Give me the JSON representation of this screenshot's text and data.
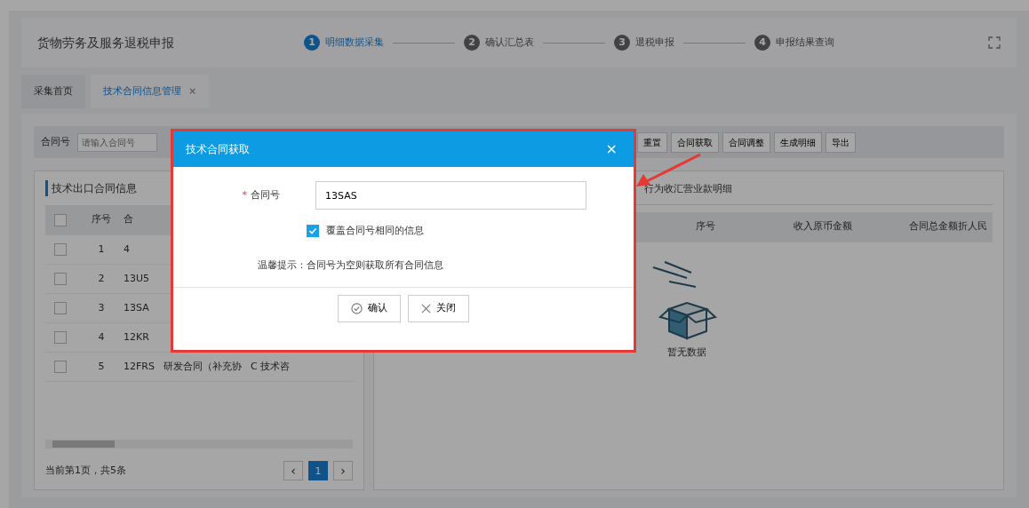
{
  "header": {
    "title": "货物劳务及服务退税申报",
    "steps": [
      {
        "number": "1",
        "label": "明细数据采集",
        "selected": true
      },
      {
        "number": "2",
        "label": "确认汇总表",
        "selected": false
      },
      {
        "number": "3",
        "label": "退税申报",
        "selected": false
      },
      {
        "number": "4",
        "label": "申报结果查询",
        "selected": false
      }
    ]
  },
  "tabs": [
    {
      "label": "采集首页",
      "selected": false
    },
    {
      "label": "技术合同信息管理",
      "selected": true,
      "close_icon": "×"
    }
  ],
  "search": {
    "label": "合同号",
    "placeholder": "请输入合同号"
  },
  "toolbar_buttons": [
    "重置",
    "合同获取",
    "合同调整",
    "生成明细",
    "导出"
  ],
  "left_panel": {
    "title": "技术出口合同信息",
    "select_all_checked": false,
    "columns": [
      "序号",
      "合"
    ],
    "rows": [
      {
        "checked": false,
        "cells": [
          "1",
          "4"
        ]
      },
      {
        "checked": false,
        "cells": [
          "2",
          "13U5"
        ]
      },
      {
        "checked": false,
        "cells": [
          "3",
          "13SA"
        ]
      },
      {
        "checked": false,
        "cells": [
          "4",
          "12KR"
        ]
      },
      {
        "checked": false,
        "cells": [
          "5",
          "12FRS",
          "研发合同（补充协",
          "C 技术咨"
        ]
      }
    ],
    "page_info": "当前第1页，共5条",
    "prev": "‹",
    "next": "›",
    "pages": [
      {
        "label": "1",
        "selected": true
      }
    ]
  },
  "right_panel": {
    "tab": "行为收汇营业款明细",
    "columns": [
      "序号",
      "收入原币金额",
      "合同总金额折人民"
    ],
    "empty_text": "暂无数据"
  },
  "dialog": {
    "title": "技术合同获取",
    "close_icon": "×",
    "required_mark": "*",
    "field_label": "合同号",
    "field_value": "13SAS",
    "overwrite": {
      "label": "覆盖合同号相同的信息",
      "checked": true
    },
    "hint": "温馨提示：合同号为空则获取所有合同信息",
    "buttons": [
      {
        "kind": "confirm",
        "label": "确认"
      },
      {
        "kind": "close",
        "label": "关闭"
      }
    ]
  }
}
